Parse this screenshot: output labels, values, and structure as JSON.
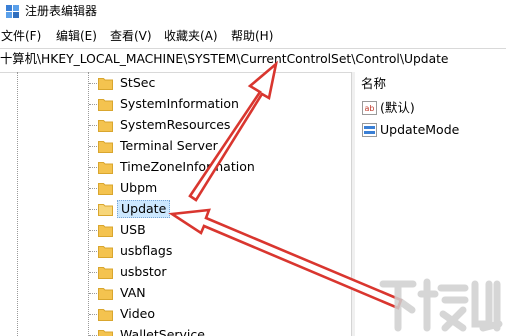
{
  "window": {
    "title": "注册表编辑器"
  },
  "menu": [
    "文件(F)",
    "编辑(E)",
    "查看(V)",
    "收藏夹(A)",
    "帮助(H)"
  ],
  "address": {
    "path": "十算机\\HKEY_LOCAL_MACHINE\\SYSTEM\\CurrentControlSet\\Control\\Update"
  },
  "tree": {
    "items": [
      {
        "label": "StSec"
      },
      {
        "label": "SystemInformation"
      },
      {
        "label": "SystemResources"
      },
      {
        "label": "Terminal Server"
      },
      {
        "label": "TimeZoneInformation"
      },
      {
        "label": "Ubpm"
      },
      {
        "label": "Update",
        "selected": true
      },
      {
        "label": "USB"
      },
      {
        "label": "usbflags"
      },
      {
        "label": "usbstor"
      },
      {
        "label": "VAN"
      },
      {
        "label": "Video"
      },
      {
        "label": "WalletService"
      }
    ]
  },
  "values_pane": {
    "header": "名称",
    "rows": [
      {
        "icon": "string-value-icon",
        "badge": "ab",
        "name": "(默认)"
      },
      {
        "icon": "dword-value-icon",
        "badge": "011\n110",
        "name": "UpdateMode"
      }
    ]
  },
  "colors": {
    "selection": "#cce8ff",
    "folder": "#f4c34f",
    "arrow": "#d9362f"
  },
  "watermark": {
    "brand": "下载吧"
  }
}
